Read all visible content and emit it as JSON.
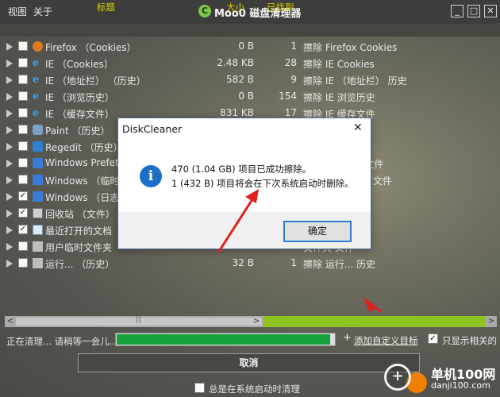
{
  "window": {
    "menu": [
      "视图",
      "关于"
    ],
    "title": "Moo0 磁盘清理器",
    "logo_letter": "C",
    "controls": [
      "_",
      "□",
      "✕"
    ]
  },
  "columns": {
    "name": "标题",
    "size": "大小",
    "found": "已找到"
  },
  "rows": [
    {
      "icon": "firefox-icon",
      "checked": false,
      "name": "Firefox （Cookies）",
      "size": "0 B",
      "count": "1",
      "desc": "擦除 Firefox Cookies"
    },
    {
      "icon": "ie-icon",
      "checked": false,
      "name": "IE （Cookies）",
      "size": "2.48 KB",
      "count": "28",
      "desc": "擦除 IE Cookies"
    },
    {
      "icon": "ie-icon",
      "checked": false,
      "name": "IE （地址栏） （历史）",
      "size": "582 B",
      "count": "9",
      "desc": "擦除 IE （地址栏） 历史"
    },
    {
      "icon": "ie-icon",
      "checked": false,
      "name": "IE （浏览历史）",
      "size": "0 B",
      "count": "154",
      "desc": "擦除 IE 浏览历史"
    },
    {
      "icon": "ie-icon",
      "checked": false,
      "name": "IE （缓存文件）",
      "size": "831 KB",
      "count": "17",
      "desc": "擦除 IE 缓存文件"
    },
    {
      "icon": "paint-icon",
      "checked": false,
      "name": "Paint （历史）",
      "size": "",
      "count": "",
      "desc": ""
    },
    {
      "icon": "regedit-icon",
      "checked": false,
      "name": "Regedit （历史）",
      "size": "",
      "count": "",
      "desc": "历史"
    },
    {
      "icon": "windows-icon",
      "checked": false,
      "name": "Windows Prefetch",
      "size": "",
      "count": "",
      "desc": "Prefetch 缓存文件"
    },
    {
      "icon": "windows-icon",
      "checked": false,
      "name": "Windows （临时",
      "size": "",
      "count": "",
      "desc": "（临时文件夹） 文件"
    },
    {
      "icon": "windows-icon",
      "checked": true,
      "name": "Windows （日志",
      "size": "",
      "count": "",
      "desc": "日志文件"
    },
    {
      "icon": "recycle-bin-icon",
      "checked": true,
      "name": "回收站 （文件）",
      "size": "",
      "count": "",
      "desc": ""
    },
    {
      "icon": "recent-docs-icon",
      "checked": true,
      "name": "最近打开的文档",
      "size": "",
      "count": "",
      "desc": "的文档 历史"
    },
    {
      "icon": "user-temp-icon",
      "checked": false,
      "name": "用户临时文件夹",
      "size": "",
      "count": "",
      "desc": "文件夹 文件"
    },
    {
      "icon": "run-icon",
      "checked": false,
      "name": "运行... （历史）",
      "size": "32 B",
      "count": "1",
      "desc": "擦除 运行... 历史"
    }
  ],
  "scrollbar": {
    "left_arrow": "<",
    "grip": "||",
    "right_arrow": ">"
  },
  "status": {
    "text": "正在清理... 请稍等一会儿...",
    "progress_fraction": 0.98,
    "add_icon": "+",
    "add_target_label": "添加自定义目标",
    "only_related_label": "只显示相关的",
    "only_related_checked": true
  },
  "cancel_label": "取消",
  "boot_clean_label": "总是在系统启动时清理",
  "watermark": {
    "name": "单机100网",
    "url": "danji100.com"
  },
  "dialog": {
    "title": "DiskCleaner",
    "close": "✕",
    "info_glyph": "i",
    "line1": "470 (1.04 GB) 项目已成功擦除。",
    "line2": "1 (432 B) 项目将会在下次系统启动时删除。",
    "ok_label": "确定"
  },
  "colors": {
    "accent_green": "#8ec21e",
    "progress_green": "#16a23a",
    "annotation_red": "#e0201a"
  }
}
